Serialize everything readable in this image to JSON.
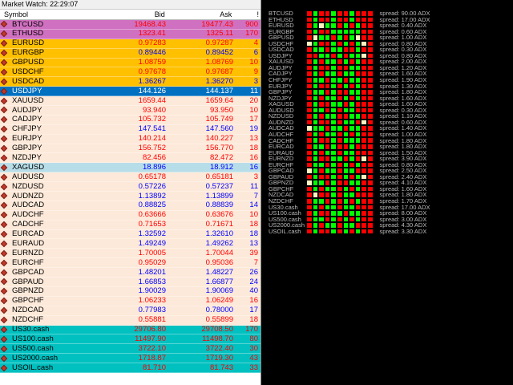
{
  "window_title": "Market Watch: 22:29:07",
  "close_label": "×",
  "columns": {
    "symbol": "Symbol",
    "bid": "Bid",
    "ask": "Ask",
    "spread": "!"
  },
  "colors": {
    "crypto_bg": "#d070c0",
    "major_bg": "#ffc000",
    "selected_bg": "#0070c0",
    "pair_bg": "#fde9d9",
    "xag_bg": "#b7dee8",
    "index_bg": "#00c0c0",
    "bid_up": "#ff0000",
    "bid_down": "#0000ff",
    "grid_green": "#00ff00",
    "grid_red": "#ff0000",
    "grid_cream": "#fff3c0"
  },
  "rows": [
    {
      "symbol": "BTCUSD",
      "bid": "19468.43",
      "ask": "19477.43",
      "spread": "900",
      "bg": "crypto",
      "dir": "up"
    },
    {
      "symbol": "ETHUSD",
      "bid": "1323.41",
      "ask": "1325.11",
      "spread": "170",
      "bg": "crypto",
      "dir": "up"
    },
    {
      "symbol": "EURUSD",
      "bid": "0.97283",
      "ask": "0.97287",
      "spread": "4",
      "bg": "major",
      "dir": "up"
    },
    {
      "symbol": "EURGBP",
      "bid": "0.89446",
      "ask": "0.89452",
      "spread": "6",
      "bg": "major",
      "dir": "down"
    },
    {
      "symbol": "GBPUSD",
      "bid": "1.08759",
      "ask": "1.08769",
      "spread": "10",
      "bg": "major",
      "dir": "up"
    },
    {
      "symbol": "USDCHF",
      "bid": "0.97678",
      "ask": "0.97687",
      "spread": "9",
      "bg": "major",
      "dir": "up"
    },
    {
      "symbol": "USDCAD",
      "bid": "1.36267",
      "ask": "1.36270",
      "spread": "3",
      "bg": "major",
      "dir": "down"
    },
    {
      "symbol": "USDJPY",
      "bid": "144.126",
      "ask": "144.137",
      "spread": "11",
      "bg": "selected",
      "dir": "sel"
    },
    {
      "symbol": "XAUUSD",
      "bid": "1659.44",
      "ask": "1659.64",
      "spread": "20",
      "bg": "pair",
      "dir": "up"
    },
    {
      "symbol": "AUDJPY",
      "bid": "93.940",
      "ask": "93.950",
      "spread": "10",
      "bg": "pair",
      "dir": "up"
    },
    {
      "symbol": "CADJPY",
      "bid": "105.732",
      "ask": "105.749",
      "spread": "17",
      "bg": "pair",
      "dir": "up"
    },
    {
      "symbol": "CHFJPY",
      "bid": "147.541",
      "ask": "147.560",
      "spread": "19",
      "bg": "pair",
      "dir": "down"
    },
    {
      "symbol": "EURJPY",
      "bid": "140.214",
      "ask": "140.227",
      "spread": "13",
      "bg": "pair",
      "dir": "up"
    },
    {
      "symbol": "GBPJPY",
      "bid": "156.752",
      "ask": "156.770",
      "spread": "18",
      "bg": "pair",
      "dir": "up"
    },
    {
      "symbol": "NZDJPY",
      "bid": "82.456",
      "ask": "82.472",
      "spread": "16",
      "bg": "pair",
      "dir": "up"
    },
    {
      "symbol": "XAGUSD",
      "bid": "18.896",
      "ask": "18.912",
      "spread": "16",
      "bg": "xag",
      "dir": "down"
    },
    {
      "symbol": "AUDUSD",
      "bid": "0.65178",
      "ask": "0.65181",
      "spread": "3",
      "bg": "pair",
      "dir": "up"
    },
    {
      "symbol": "NZDUSD",
      "bid": "0.57226",
      "ask": "0.57237",
      "spread": "11",
      "bg": "pair",
      "dir": "down"
    },
    {
      "symbol": "AUDNZD",
      "bid": "1.13892",
      "ask": "1.13899",
      "spread": "7",
      "bg": "pair",
      "dir": "down"
    },
    {
      "symbol": "AUDCAD",
      "bid": "0.88825",
      "ask": "0.88839",
      "spread": "14",
      "bg": "pair",
      "dir": "down"
    },
    {
      "symbol": "AUDCHF",
      "bid": "0.63666",
      "ask": "0.63676",
      "spread": "10",
      "bg": "pair",
      "dir": "up"
    },
    {
      "symbol": "CADCHF",
      "bid": "0.71653",
      "ask": "0.71671",
      "spread": "18",
      "bg": "pair",
      "dir": "up"
    },
    {
      "symbol": "EURCAD",
      "bid": "1.32592",
      "ask": "1.32610",
      "spread": "18",
      "bg": "pair",
      "dir": "down"
    },
    {
      "symbol": "EURAUD",
      "bid": "1.49249",
      "ask": "1.49262",
      "spread": "13",
      "bg": "pair",
      "dir": "down"
    },
    {
      "symbol": "EURNZD",
      "bid": "1.70005",
      "ask": "1.70044",
      "spread": "39",
      "bg": "pair",
      "dir": "up"
    },
    {
      "symbol": "EURCHF",
      "bid": "0.95029",
      "ask": "0.95036",
      "spread": "7",
      "bg": "pair",
      "dir": "up"
    },
    {
      "symbol": "GBPCAD",
      "bid": "1.48201",
      "ask": "1.48227",
      "spread": "26",
      "bg": "pair",
      "dir": "down"
    },
    {
      "symbol": "GBPAUD",
      "bid": "1.66853",
      "ask": "1.66877",
      "spread": "24",
      "bg": "pair",
      "dir": "down"
    },
    {
      "symbol": "GBPNZD",
      "bid": "1.90029",
      "ask": "1.90069",
      "spread": "40",
      "bg": "pair",
      "dir": "down"
    },
    {
      "symbol": "GBPCHF",
      "bid": "1.06233",
      "ask": "1.06249",
      "spread": "16",
      "bg": "pair",
      "dir": "up"
    },
    {
      "symbol": "NZDCAD",
      "bid": "0.77983",
      "ask": "0.78000",
      "spread": "17",
      "bg": "pair",
      "dir": "down"
    },
    {
      "symbol": "NZDCHF",
      "bid": "0.55881",
      "ask": "0.55899",
      "spread": "18",
      "bg": "pair",
      "dir": "up"
    },
    {
      "symbol": "US30.cash",
      "bid": "29706.80",
      "ask": "29708.50",
      "spread": "170",
      "bg": "index",
      "dir": "up"
    },
    {
      "symbol": "US100.cash",
      "bid": "11497.90",
      "ask": "11498.70",
      "spread": "80",
      "bg": "index",
      "dir": "up"
    },
    {
      "symbol": "US500.cash",
      "bid": "3722.10",
      "ask": "3722.40",
      "spread": "30",
      "bg": "index",
      "dir": "up"
    },
    {
      "symbol": "US2000.cash",
      "bid": "1718.87",
      "ask": "1719.30",
      "spread": "43",
      "bg": "index",
      "dir": "up"
    },
    {
      "symbol": "USOIL.cash",
      "bid": "81.710",
      "ask": "81.743",
      "spread": "33",
      "bg": "index",
      "dir": "up"
    }
  ],
  "heatmap": {
    "rows": [
      {
        "symbol": "BTCUSD",
        "spread": "spread: 90.00 ADX",
        "cells": "RGRRGRRGRRR"
      },
      {
        "symbol": "ETHUSD",
        "spread": "spread: 17.00 ADX",
        "cells": "RGRRGRRGRRR"
      },
      {
        "symbol": "EURUSD",
        "spread": "spread: 0.40 ADX",
        "cells": "RGCGGRGRGRR"
      },
      {
        "symbol": "EURGBP",
        "spread": "spread: 0.60 ADX",
        "cells": "RGRRGGGGGRR"
      },
      {
        "symbol": "GBPUSD",
        "spread": "spread: 1.00 ADX",
        "cells": "RCGGRGRGCRR"
      },
      {
        "symbol": "USDCHF",
        "spread": "spread: 0.80 ADX",
        "cells": "CGRRGRGRGCR"
      },
      {
        "symbol": "USDCAD",
        "spread": "spread: 0.30 ADX",
        "cells": "RGGRGGRRGRR"
      },
      {
        "symbol": "USDJPY",
        "spread": "spread: 0.80 ADX",
        "cells": "RRGGRGRGGCR"
      },
      {
        "symbol": "XAUUSD",
        "spread": "spread: 2.00 ADX",
        "cells": "RGRGGRGRGRR"
      },
      {
        "symbol": "AUDJPY",
        "spread": "spread: 1.20 ADX",
        "cells": "RGRRGRRGGRR"
      },
      {
        "symbol": "CADJPY",
        "spread": "spread: 1.60 ADX",
        "cells": "RGRGGRGGRRR"
      },
      {
        "symbol": "CHFJPY",
        "spread": "spread: 1.90 ADX",
        "cells": "RGGRGGRGGRR"
      },
      {
        "symbol": "EURJPY",
        "spread": "spread: 1.30 ADX",
        "cells": "RGRRGRGRGRR"
      },
      {
        "symbol": "GBPJPY",
        "spread": "spread: 1.80 ADX",
        "cells": "RGGRGRRGGRR"
      },
      {
        "symbol": "NZDJPY",
        "spread": "spread: 1.60 ADX",
        "cells": "RGRGGRGRGRR"
      },
      {
        "symbol": "XAGUSD",
        "spread": "spread: 1.60 ADX",
        "cells": "RGRRGGRGRRR"
      },
      {
        "symbol": "AUDUSD",
        "spread": "spread: 0.30 ADX",
        "cells": "RGGRGRGGRRR"
      },
      {
        "symbol": "NZDUSD",
        "spread": "spread: 1.10 ADX",
        "cells": "RGRGGRRGGRR"
      },
      {
        "symbol": "AUDNZD",
        "spread": "spread: 0.60 ADX",
        "cells": "RGRRGRGGRCR"
      },
      {
        "symbol": "AUDCAD",
        "spread": "spread: 1.40 ADX",
        "cells": "CGGRGGRGGRR"
      },
      {
        "symbol": "AUDCHF",
        "spread": "spread: 1.00 ADX",
        "cells": "RGRGGRGRGRR"
      },
      {
        "symbol": "CADCHF",
        "spread": "spread: 1.80 ADX",
        "cells": "RGRRGRGGGRR"
      },
      {
        "symbol": "EURCAD",
        "spread": "spread: 1.80 ADX",
        "cells": "RGGRGRRGRRR"
      },
      {
        "symbol": "EURAUD",
        "spread": "spread: 1.50 ADX",
        "cells": "RGRGGRGGRRR"
      },
      {
        "symbol": "EURNZD",
        "spread": "spread: 3.90 ADX",
        "cells": "RGRRGGRGRCR"
      },
      {
        "symbol": "EURCHF",
        "spread": "spread: 0.80 ADX",
        "cells": "RGGRGRGRGRR"
      },
      {
        "symbol": "GBPCAD",
        "spread": "spread: 2.50 ADX",
        "cells": "CGRGGRGGRRR"
      },
      {
        "symbol": "GBPAUD",
        "spread": "spread: 2.40 ADX",
        "cells": "RGRRGRGRGCR"
      },
      {
        "symbol": "GBPNZD",
        "spread": "spread: 4.10 ADX",
        "cells": "CGGRGRRGGRR"
      },
      {
        "symbol": "GBPCHF",
        "spread": "spread: 1.60 ADX",
        "cells": "RGRGGRGRGRR"
      },
      {
        "symbol": "NZDCAD",
        "spread": "spread: 1.80 ADX",
        "cells": "RCRRGRGGRRR"
      },
      {
        "symbol": "NZDCHF",
        "spread": "spread: 1.70 ADX",
        "cells": "RGGRGRGRGRR"
      },
      {
        "symbol": "US30.cash",
        "spread": "spread: 17.00 ADX",
        "cells": "RGRGGRGGRRR"
      },
      {
        "symbol": "US100.cash",
        "spread": "spread: 8.00 ADX",
        "cells": "RGRRGGRGGRR"
      },
      {
        "symbol": "US500.cash",
        "spread": "spread: 3.00 ADX",
        "cells": "RGGRGRGRGRR"
      },
      {
        "symbol": "US2000.cash",
        "spread": "spread: 4.30 ADX",
        "cells": "RGRGGRGGRRR"
      },
      {
        "symbol": "USOIL.cash",
        "spread": "spread: 3.30 ADX",
        "cells": "RGRRGRGRGRR"
      }
    ]
  }
}
